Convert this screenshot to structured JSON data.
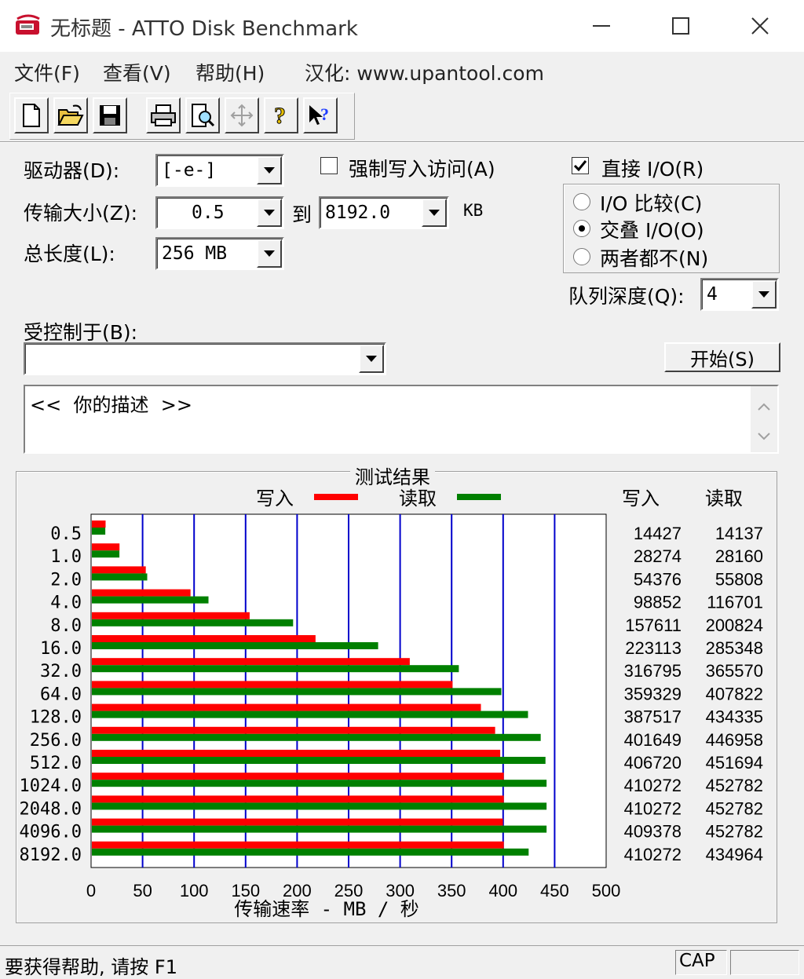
{
  "window": {
    "title": "无标题 - ATTO Disk Benchmark"
  },
  "menu": {
    "file": "文件(F)",
    "view": "查看(V)",
    "help": "帮助(H)",
    "localization": "汉化: www.upantool.com"
  },
  "toolbar": {
    "icons": [
      "new-icon",
      "open-icon",
      "save-icon",
      "print-icon",
      "print-preview-icon",
      "move-icon",
      "help-icon",
      "context-help-icon"
    ]
  },
  "form": {
    "drive_label": "驱动器(D):",
    "drive_value": "[-e-]",
    "transfer_label": "传输大小(Z):",
    "transfer_from": "0.5",
    "to_label": "到",
    "transfer_to": "8192.0",
    "kb_label": "KB",
    "total_label": "总长度(L):",
    "total_value": "256 MB",
    "force_write_label": "强制写入访问(A)",
    "force_write_checked": false,
    "direct_io_label": "直接 I/O(R)",
    "direct_io_checked": true,
    "io_compare_label": "I/O 比较(C)",
    "overlap_io_label": "交叠 I/O(O)",
    "neither_label": "两者都不(N)",
    "selected_mode": "overlap",
    "queue_label": "队列深度(Q):",
    "queue_value": "4",
    "controlled_label": "受控制于(B):",
    "controlled_value": "",
    "start_button": "开始(S)",
    "description": "<<  你的描述  >>"
  },
  "results": {
    "title": "测试结果",
    "legend_write": "写入",
    "legend_read": "读取",
    "col_write": "写入",
    "col_read": "读取"
  },
  "colors": {
    "write": "#ff0000",
    "read": "#008000",
    "grid": "#0000cc"
  },
  "chart_data": {
    "type": "bar",
    "orientation": "horizontal",
    "xlabel": "传输速率 - MB / 秒",
    "xlim": [
      0,
      500
    ],
    "xticks": [
      0,
      50,
      100,
      150,
      200,
      250,
      300,
      350,
      400,
      450,
      500
    ],
    "categories": [
      "0.5",
      "1.0",
      "2.0",
      "4.0",
      "8.0",
      "16.0",
      "32.0",
      "64.0",
      "128.0",
      "256.0",
      "512.0",
      "1024.0",
      "2048.0",
      "4096.0",
      "8192.0"
    ],
    "series": [
      {
        "name": "写入",
        "values": [
          14427,
          28274,
          54376,
          98852,
          157611,
          223113,
          316795,
          359329,
          387517,
          401649,
          406720,
          410272,
          410272,
          409378,
          410272
        ]
      },
      {
        "name": "读取",
        "values": [
          14137,
          28160,
          55808,
          116701,
          200824,
          285348,
          365570,
          407822,
          434335,
          446958,
          451694,
          452782,
          452782,
          452782,
          434964
        ]
      }
    ],
    "unit_divisor": 1024,
    "grid": true,
    "legend_placement": "top"
  },
  "status": {
    "help_text": "要获得帮助, 请按 F1",
    "cap": "CAP"
  }
}
